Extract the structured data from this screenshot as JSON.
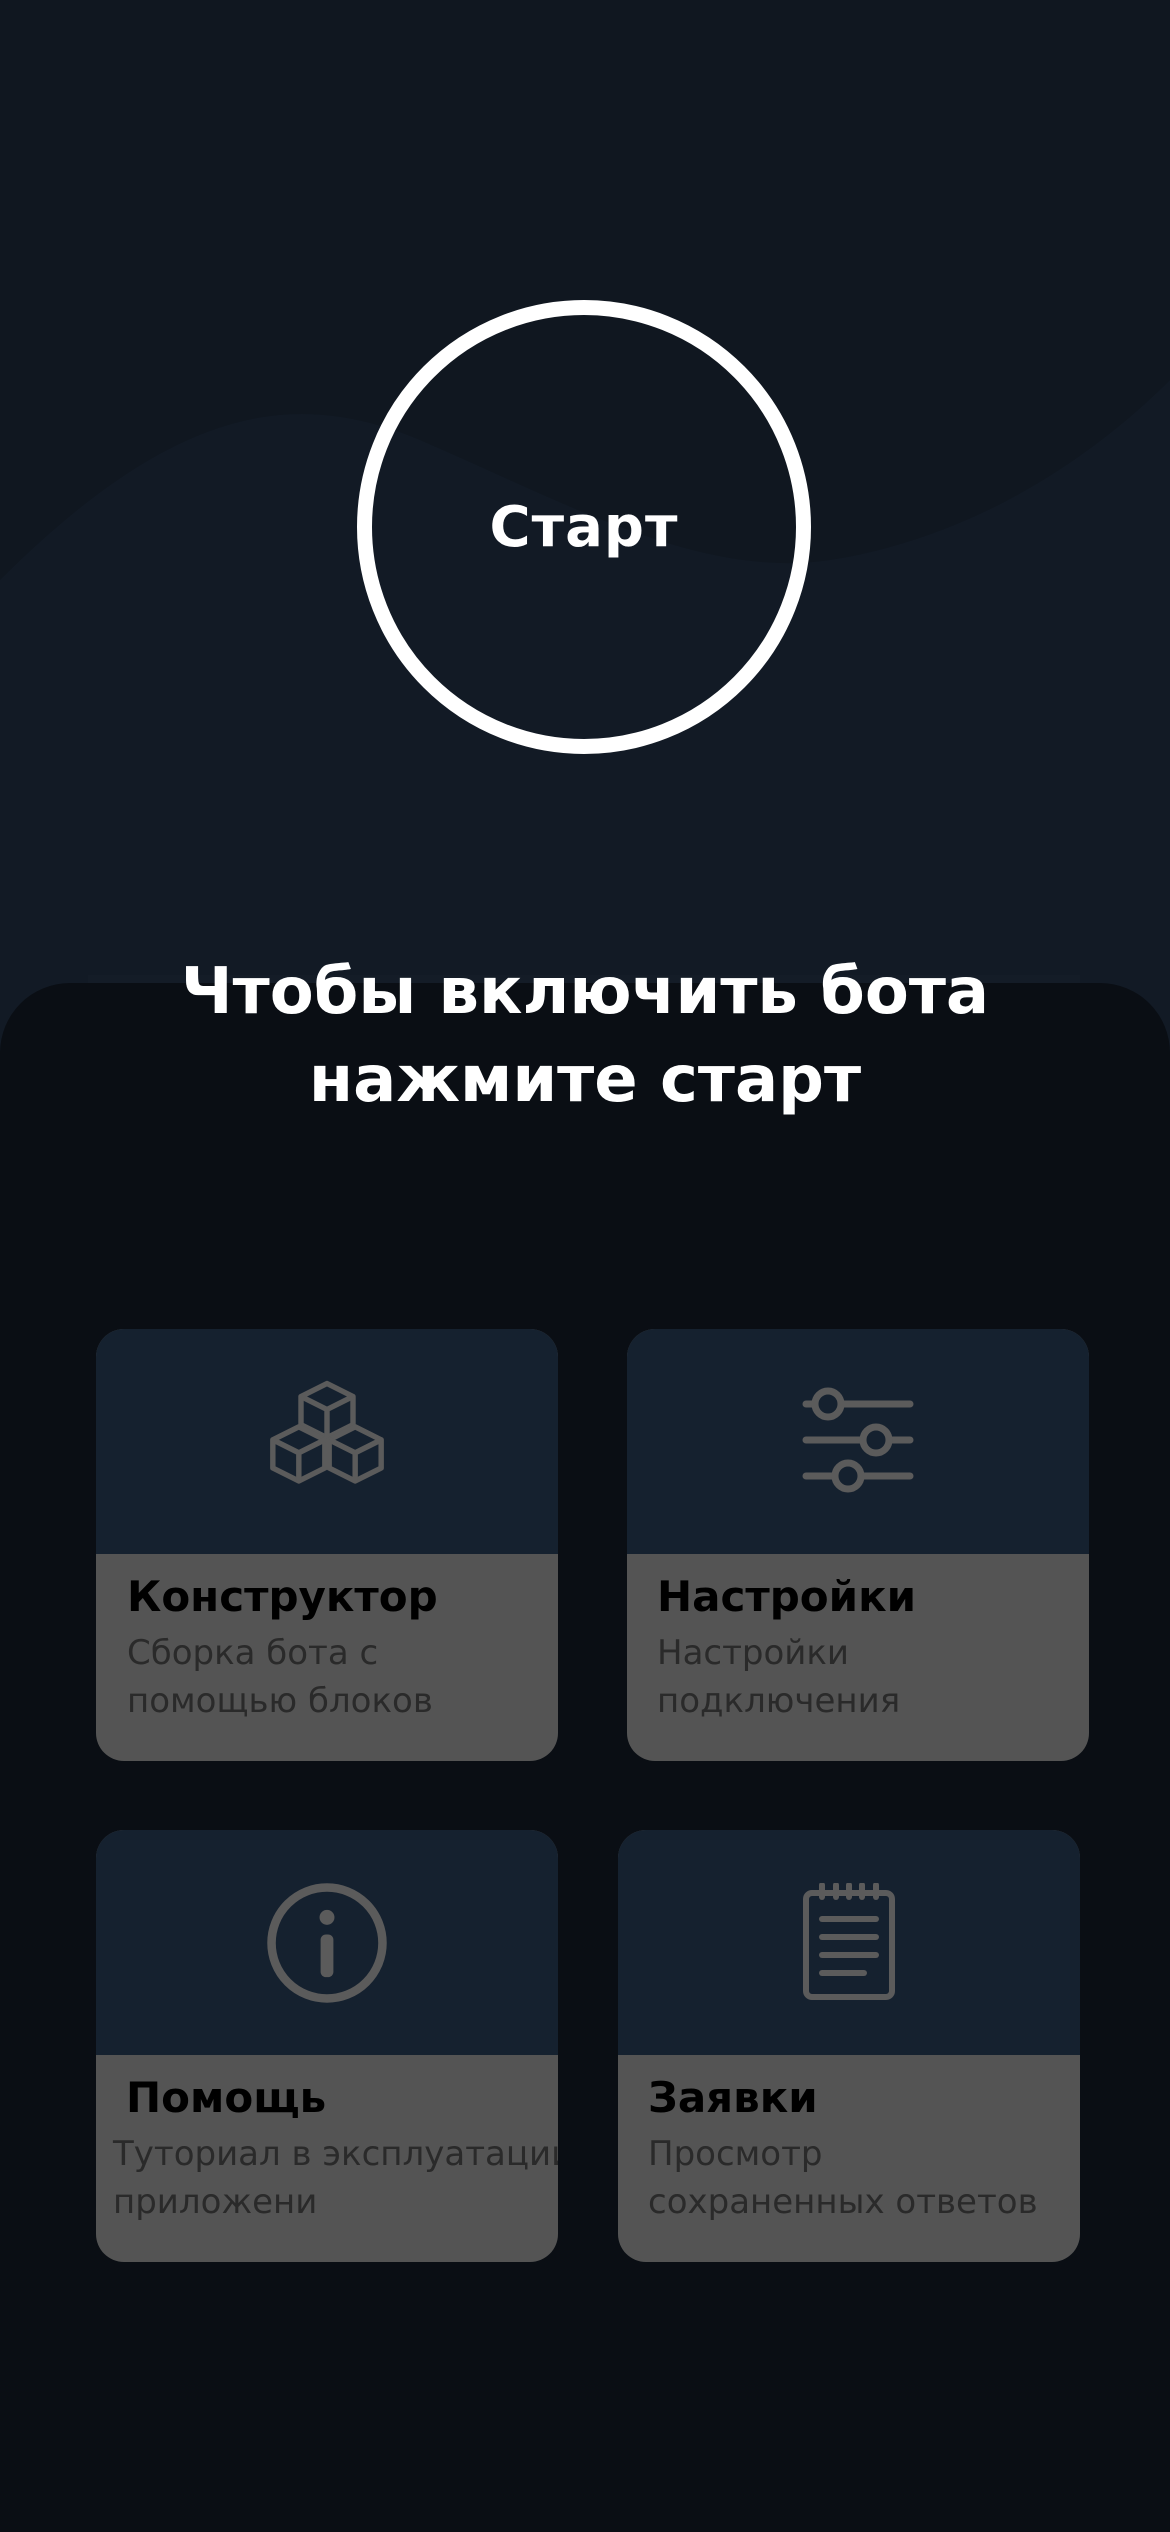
{
  "start_button": {
    "label": "Старт"
  },
  "prompt": {
    "line1": "Чтобы включить бота",
    "line2": "нажмите старт"
  },
  "cards": [
    {
      "title": "Конструктор",
      "desc_line1": "Сборка бота с",
      "desc_line2": "помощью блоков",
      "icon": "cubes-icon"
    },
    {
      "title": "Настройки",
      "desc_line1": "Настройки",
      "desc_line2": "подключения",
      "icon": "sliders-icon"
    },
    {
      "title": "Помощь",
      "desc_line1": "Туториал в эксплуатации",
      "desc_line2": "приложени",
      "icon": "info-icon"
    },
    {
      "title": "Заявки",
      "desc_line1": "Просмотр",
      "desc_line2": "сохраненных ответов",
      "icon": "notepad-icon"
    }
  ],
  "colors": {
    "background_top": "#121a25",
    "background_bottom": "#0a0e14",
    "card_header": "#15212f",
    "card_body": "#545454",
    "icon": "#5b5b5b",
    "text_light": "#ffffff"
  }
}
